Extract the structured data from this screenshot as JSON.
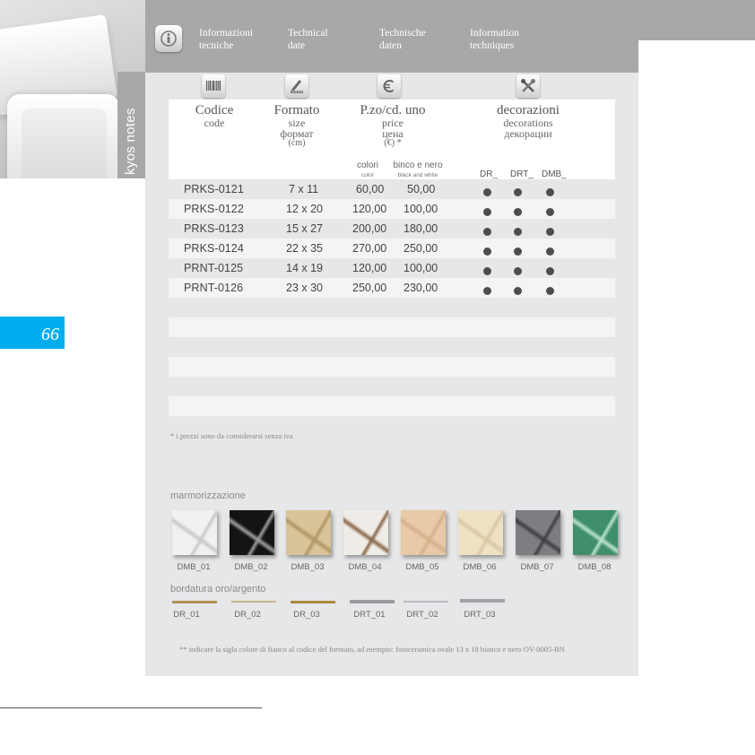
{
  "sidebar": {
    "product_label": "kyos notes",
    "page_number": "66"
  },
  "header": {
    "languages": [
      {
        "line1": "Informazioni",
        "line2": "tecniche"
      },
      {
        "line1": "Technical",
        "line2": "date"
      },
      {
        "line1": "Technische",
        "line2": "daten"
      },
      {
        "line1": "Information",
        "line2": "techniques"
      }
    ]
  },
  "icons": {
    "info": "info-icon",
    "code": "barcode-icon",
    "format": "ruler-pencil-icon",
    "price": "euro-icon",
    "decorations": "tools-icon"
  },
  "table": {
    "headers": {
      "code": {
        "main": "Codice",
        "sub": [
          "code"
        ]
      },
      "format": {
        "main": "Formato",
        "sub": [
          "size",
          "формат"
        ],
        "unit": "(cm)"
      },
      "price": {
        "main": "P.zo/cd. uno",
        "sub": [
          "price",
          "цена"
        ],
        "unit": "(€) *"
      },
      "decorations": {
        "main": "decorazioni",
        "sub": [
          "decorations",
          "декорации"
        ]
      }
    },
    "price_columns": {
      "color": {
        "label": "colori",
        "sub": "color"
      },
      "bw": {
        "label": "binco e nero",
        "sub": "black and white"
      }
    },
    "decoration_columns": [
      "DR_",
      "DRT_",
      "DMB_"
    ],
    "rows": [
      {
        "code": "PRKS-0121",
        "size": "7 x 11",
        "color": "60,00",
        "bw": "50,00"
      },
      {
        "code": "PRKS-0122",
        "size": "12 x 20",
        "color": "120,00",
        "bw": "100,00"
      },
      {
        "code": "PRKS-0123",
        "size": "15 x 27",
        "color": "200,00",
        "bw": "180,00"
      },
      {
        "code": "PRKS-0124",
        "size": "22 x 35",
        "color": "270,00",
        "bw": "250,00"
      },
      {
        "code": "PRNT-0125",
        "size": "14 x 19",
        "color": "120,00",
        "bw": "100,00"
      },
      {
        "code": "PRNT-0126",
        "size": "23 x 30",
        "color": "250,00",
        "bw": "230,00"
      }
    ]
  },
  "footnote_vat": "* i prezzi sono da considerarsi senza iva",
  "marble": {
    "title": "marmorizzazione",
    "items": [
      {
        "label": "DMB_01",
        "base": "#f1f1f1",
        "vein": "#c9c9c9"
      },
      {
        "label": "DMB_02",
        "base": "#141414",
        "vein": "#9a9a9a"
      },
      {
        "label": "DMB_03",
        "base": "#d9c49a",
        "vein": "#b29665"
      },
      {
        "label": "DMB_04",
        "base": "#efebe6",
        "vein": "#8b6b4e"
      },
      {
        "label": "DMB_05",
        "base": "#e8c9a8",
        "vein": "#d6b08a"
      },
      {
        "label": "DMB_06",
        "base": "#efe1c4",
        "vein": "#dac8a4"
      },
      {
        "label": "DMB_07",
        "base": "#7d7e82",
        "vein": "#3e3f44"
      },
      {
        "label": "DMB_08",
        "base": "#3f8f6a",
        "vein": "#b9e2cd"
      }
    ]
  },
  "border": {
    "title": "bordatura oro/argento",
    "items": [
      {
        "label": "DR_01",
        "color": "#b09456"
      },
      {
        "label": "DR_02",
        "color": "#c7b58a"
      },
      {
        "label": "DR_03",
        "color": "#a9893f"
      },
      {
        "label": "DRT_01",
        "color": "#9a9b9e"
      },
      {
        "label": "DRT_02",
        "color": "#b9babd"
      },
      {
        "label": "DRT_03",
        "color": "#a3a4a7"
      }
    ]
  },
  "footnote_format": "** indicare la sigla colore di fianco al codice del formato, ad esempio: fotoceramica ovale 13 x 18 bianco e nero OV-0005-BN"
}
